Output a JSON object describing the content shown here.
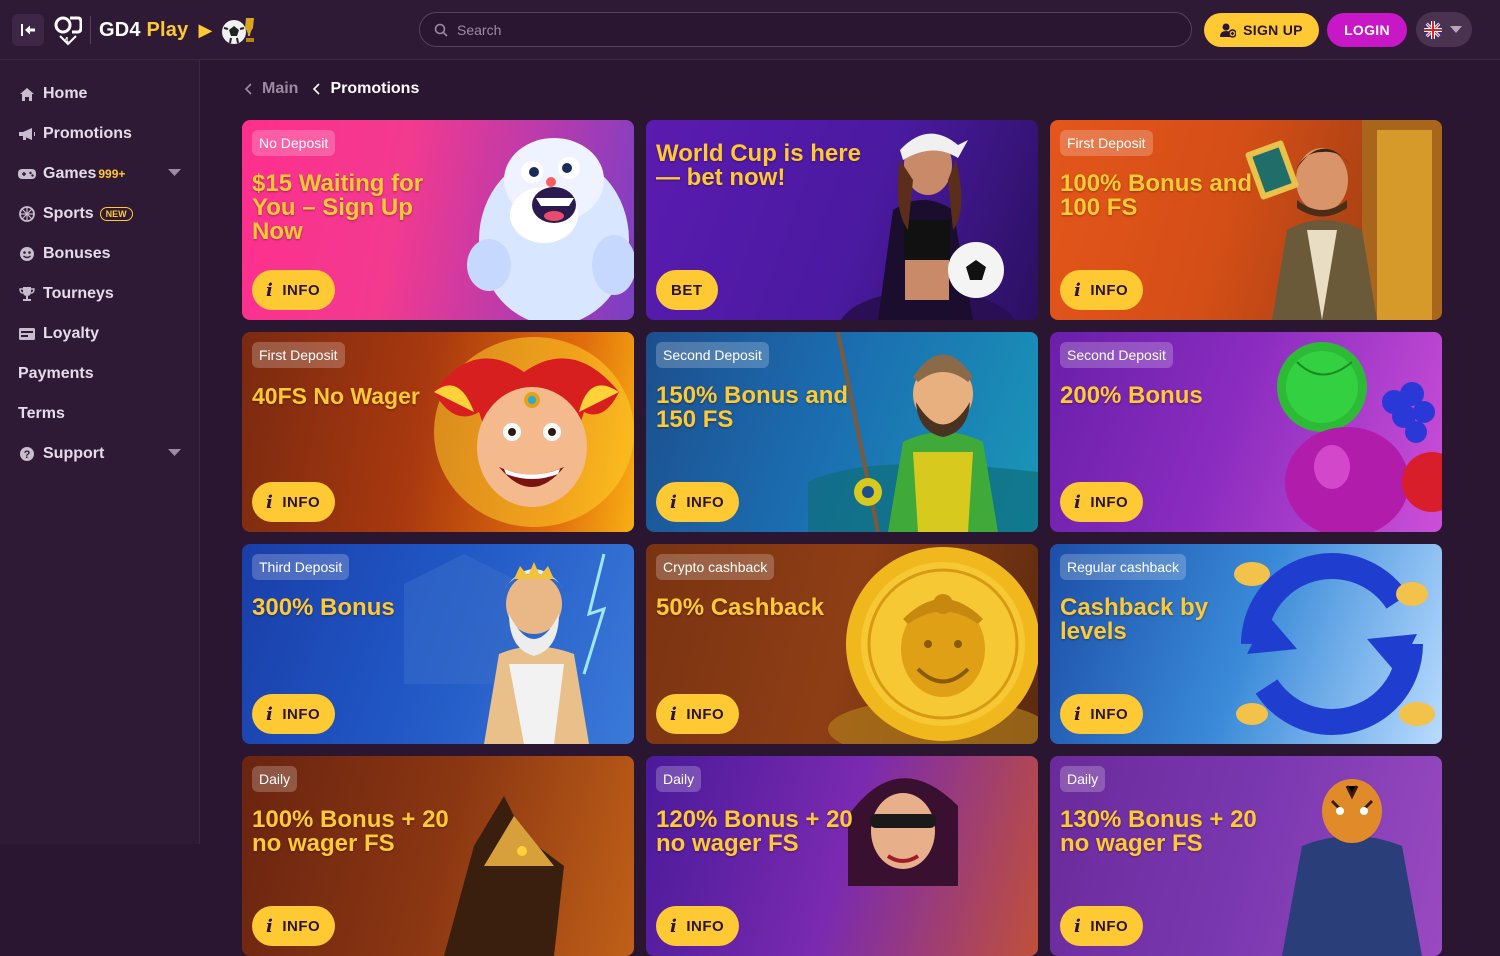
{
  "header": {
    "logo_prefix": "GD4",
    "logo_suffix": "Play",
    "search_placeholder": "Search",
    "signup_label": "SIGN UP",
    "login_label": "LOGIN",
    "language_icon": "uk-flag-icon"
  },
  "sidebar": {
    "items": [
      {
        "label": "Home",
        "icon": "home-icon"
      },
      {
        "label": "Promotions",
        "icon": "megaphone-icon"
      },
      {
        "label": "Games",
        "icon": "gamepad-icon",
        "count": "999+"
      },
      {
        "label": "Sports",
        "icon": "sports-icon",
        "badge": "NEW"
      },
      {
        "label": "Bonuses",
        "icon": "bonus-icon"
      },
      {
        "label": "Tourneys",
        "icon": "trophy-icon"
      },
      {
        "label": "Loyalty",
        "icon": "loyalty-icon"
      },
      {
        "label": "Payments"
      },
      {
        "label": "Terms"
      },
      {
        "label": "Support",
        "icon": "help-icon"
      }
    ]
  },
  "breadcrumb": {
    "main": "Main",
    "current": "Promotions"
  },
  "promotions": [
    {
      "tag": "No Deposit",
      "title": "$15 Waiting for You – Sign Up Now",
      "button": "INFO"
    },
    {
      "tag": "",
      "title": "World Cup is here — bet now!",
      "button": "BET"
    },
    {
      "tag": "First Deposit",
      "title": "100% Bonus and 100 FS",
      "button": "INFO"
    },
    {
      "tag": "First Deposit",
      "title": "40FS No Wager",
      "button": "INFO"
    },
    {
      "tag": "Second Deposit",
      "title": "150% Bonus and 150 FS",
      "button": "INFO"
    },
    {
      "tag": "Second Deposit",
      "title": "200% Bonus",
      "button": "INFO"
    },
    {
      "tag": "Third Deposit",
      "title": "300% Bonus",
      "button": "INFO"
    },
    {
      "tag": "Crypto cashback",
      "title": "50% Cashback",
      "button": "INFO"
    },
    {
      "tag": "Regular cashback",
      "title": "Cashback by levels",
      "button": "INFO"
    },
    {
      "tag": "Daily",
      "title": "100% Bonus + 20 no wager FS",
      "button": "INFO"
    },
    {
      "tag": "Daily",
      "title": "120% Bonus + 20 no wager FS",
      "button": "INFO"
    },
    {
      "tag": "Daily",
      "title": "130% Bonus + 20 no wager FS",
      "button": "INFO"
    }
  ],
  "colors": {
    "accent": "#ffc933",
    "login": "#c817c6",
    "background": "#2a1630"
  }
}
